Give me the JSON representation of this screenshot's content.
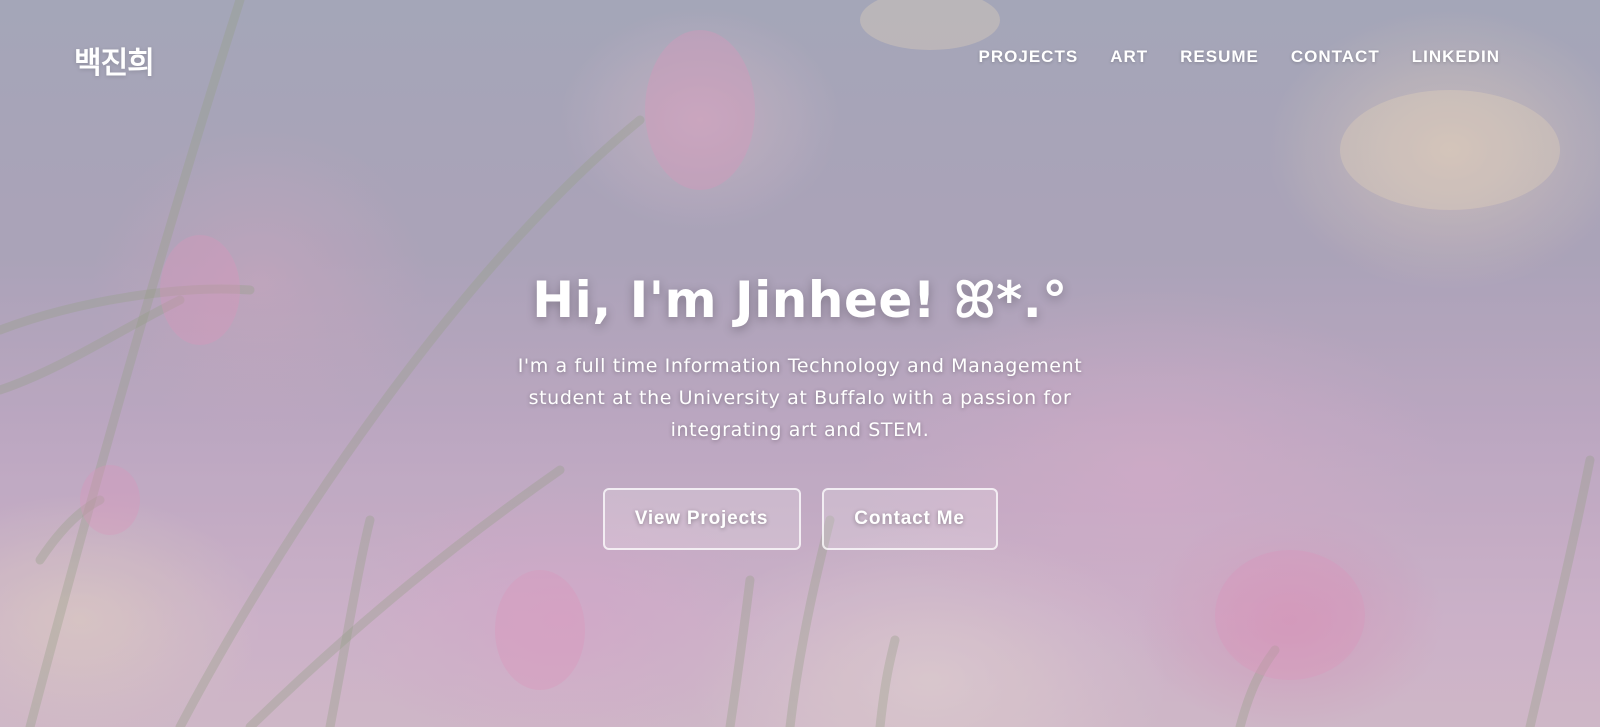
{
  "nav": {
    "logo": "백진희",
    "items": [
      {
        "label": "PROJECTS"
      },
      {
        "label": "ART"
      },
      {
        "label": "RESUME"
      },
      {
        "label": "CONTACT"
      },
      {
        "label": "LINKEDIN"
      }
    ]
  },
  "hero": {
    "title": "Hi, I'm Jinhee! ꕤ*.°",
    "subtitle": "I'm a full time Information Technology and Management student at the University at Buffalo with a passion for integrating art and STEM.",
    "buttons": {
      "projects": "View Projects",
      "contact": "Contact Me"
    }
  },
  "colors": {
    "text": "#ffffff",
    "button_border": "rgba(255,255,255,0.75)"
  }
}
